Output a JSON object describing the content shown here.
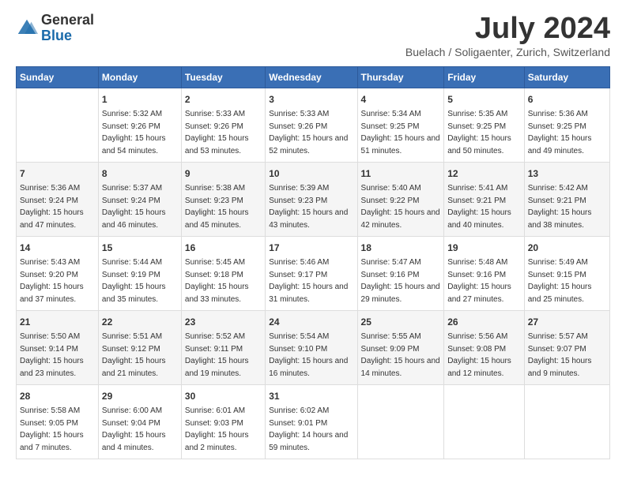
{
  "header": {
    "logo_general": "General",
    "logo_blue": "Blue",
    "month_title": "July 2024",
    "location": "Buelach / Soligaenter, Zurich, Switzerland"
  },
  "weekdays": [
    "Sunday",
    "Monday",
    "Tuesday",
    "Wednesday",
    "Thursday",
    "Friday",
    "Saturday"
  ],
  "weeks": [
    [
      {
        "day": "",
        "sunrise": "",
        "sunset": "",
        "daylight": ""
      },
      {
        "day": "1",
        "sunrise": "Sunrise: 5:32 AM",
        "sunset": "Sunset: 9:26 PM",
        "daylight": "Daylight: 15 hours and 54 minutes."
      },
      {
        "day": "2",
        "sunrise": "Sunrise: 5:33 AM",
        "sunset": "Sunset: 9:26 PM",
        "daylight": "Daylight: 15 hours and 53 minutes."
      },
      {
        "day": "3",
        "sunrise": "Sunrise: 5:33 AM",
        "sunset": "Sunset: 9:26 PM",
        "daylight": "Daylight: 15 hours and 52 minutes."
      },
      {
        "day": "4",
        "sunrise": "Sunrise: 5:34 AM",
        "sunset": "Sunset: 9:25 PM",
        "daylight": "Daylight: 15 hours and 51 minutes."
      },
      {
        "day": "5",
        "sunrise": "Sunrise: 5:35 AM",
        "sunset": "Sunset: 9:25 PM",
        "daylight": "Daylight: 15 hours and 50 minutes."
      },
      {
        "day": "6",
        "sunrise": "Sunrise: 5:36 AM",
        "sunset": "Sunset: 9:25 PM",
        "daylight": "Daylight: 15 hours and 49 minutes."
      }
    ],
    [
      {
        "day": "7",
        "sunrise": "Sunrise: 5:36 AM",
        "sunset": "Sunset: 9:24 PM",
        "daylight": "Daylight: 15 hours and 47 minutes."
      },
      {
        "day": "8",
        "sunrise": "Sunrise: 5:37 AM",
        "sunset": "Sunset: 9:24 PM",
        "daylight": "Daylight: 15 hours and 46 minutes."
      },
      {
        "day": "9",
        "sunrise": "Sunrise: 5:38 AM",
        "sunset": "Sunset: 9:23 PM",
        "daylight": "Daylight: 15 hours and 45 minutes."
      },
      {
        "day": "10",
        "sunrise": "Sunrise: 5:39 AM",
        "sunset": "Sunset: 9:23 PM",
        "daylight": "Daylight: 15 hours and 43 minutes."
      },
      {
        "day": "11",
        "sunrise": "Sunrise: 5:40 AM",
        "sunset": "Sunset: 9:22 PM",
        "daylight": "Daylight: 15 hours and 42 minutes."
      },
      {
        "day": "12",
        "sunrise": "Sunrise: 5:41 AM",
        "sunset": "Sunset: 9:21 PM",
        "daylight": "Daylight: 15 hours and 40 minutes."
      },
      {
        "day": "13",
        "sunrise": "Sunrise: 5:42 AM",
        "sunset": "Sunset: 9:21 PM",
        "daylight": "Daylight: 15 hours and 38 minutes."
      }
    ],
    [
      {
        "day": "14",
        "sunrise": "Sunrise: 5:43 AM",
        "sunset": "Sunset: 9:20 PM",
        "daylight": "Daylight: 15 hours and 37 minutes."
      },
      {
        "day": "15",
        "sunrise": "Sunrise: 5:44 AM",
        "sunset": "Sunset: 9:19 PM",
        "daylight": "Daylight: 15 hours and 35 minutes."
      },
      {
        "day": "16",
        "sunrise": "Sunrise: 5:45 AM",
        "sunset": "Sunset: 9:18 PM",
        "daylight": "Daylight: 15 hours and 33 minutes."
      },
      {
        "day": "17",
        "sunrise": "Sunrise: 5:46 AM",
        "sunset": "Sunset: 9:17 PM",
        "daylight": "Daylight: 15 hours and 31 minutes."
      },
      {
        "day": "18",
        "sunrise": "Sunrise: 5:47 AM",
        "sunset": "Sunset: 9:16 PM",
        "daylight": "Daylight: 15 hours and 29 minutes."
      },
      {
        "day": "19",
        "sunrise": "Sunrise: 5:48 AM",
        "sunset": "Sunset: 9:16 PM",
        "daylight": "Daylight: 15 hours and 27 minutes."
      },
      {
        "day": "20",
        "sunrise": "Sunrise: 5:49 AM",
        "sunset": "Sunset: 9:15 PM",
        "daylight": "Daylight: 15 hours and 25 minutes."
      }
    ],
    [
      {
        "day": "21",
        "sunrise": "Sunrise: 5:50 AM",
        "sunset": "Sunset: 9:14 PM",
        "daylight": "Daylight: 15 hours and 23 minutes."
      },
      {
        "day": "22",
        "sunrise": "Sunrise: 5:51 AM",
        "sunset": "Sunset: 9:12 PM",
        "daylight": "Daylight: 15 hours and 21 minutes."
      },
      {
        "day": "23",
        "sunrise": "Sunrise: 5:52 AM",
        "sunset": "Sunset: 9:11 PM",
        "daylight": "Daylight: 15 hours and 19 minutes."
      },
      {
        "day": "24",
        "sunrise": "Sunrise: 5:54 AM",
        "sunset": "Sunset: 9:10 PM",
        "daylight": "Daylight: 15 hours and 16 minutes."
      },
      {
        "day": "25",
        "sunrise": "Sunrise: 5:55 AM",
        "sunset": "Sunset: 9:09 PM",
        "daylight": "Daylight: 15 hours and 14 minutes."
      },
      {
        "day": "26",
        "sunrise": "Sunrise: 5:56 AM",
        "sunset": "Sunset: 9:08 PM",
        "daylight": "Daylight: 15 hours and 12 minutes."
      },
      {
        "day": "27",
        "sunrise": "Sunrise: 5:57 AM",
        "sunset": "Sunset: 9:07 PM",
        "daylight": "Daylight: 15 hours and 9 minutes."
      }
    ],
    [
      {
        "day": "28",
        "sunrise": "Sunrise: 5:58 AM",
        "sunset": "Sunset: 9:05 PM",
        "daylight": "Daylight: 15 hours and 7 minutes."
      },
      {
        "day": "29",
        "sunrise": "Sunrise: 6:00 AM",
        "sunset": "Sunset: 9:04 PM",
        "daylight": "Daylight: 15 hours and 4 minutes."
      },
      {
        "day": "30",
        "sunrise": "Sunrise: 6:01 AM",
        "sunset": "Sunset: 9:03 PM",
        "daylight": "Daylight: 15 hours and 2 minutes."
      },
      {
        "day": "31",
        "sunrise": "Sunrise: 6:02 AM",
        "sunset": "Sunset: 9:01 PM",
        "daylight": "Daylight: 14 hours and 59 minutes."
      },
      {
        "day": "",
        "sunrise": "",
        "sunset": "",
        "daylight": ""
      },
      {
        "day": "",
        "sunrise": "",
        "sunset": "",
        "daylight": ""
      },
      {
        "day": "",
        "sunrise": "",
        "sunset": "",
        "daylight": ""
      }
    ]
  ]
}
